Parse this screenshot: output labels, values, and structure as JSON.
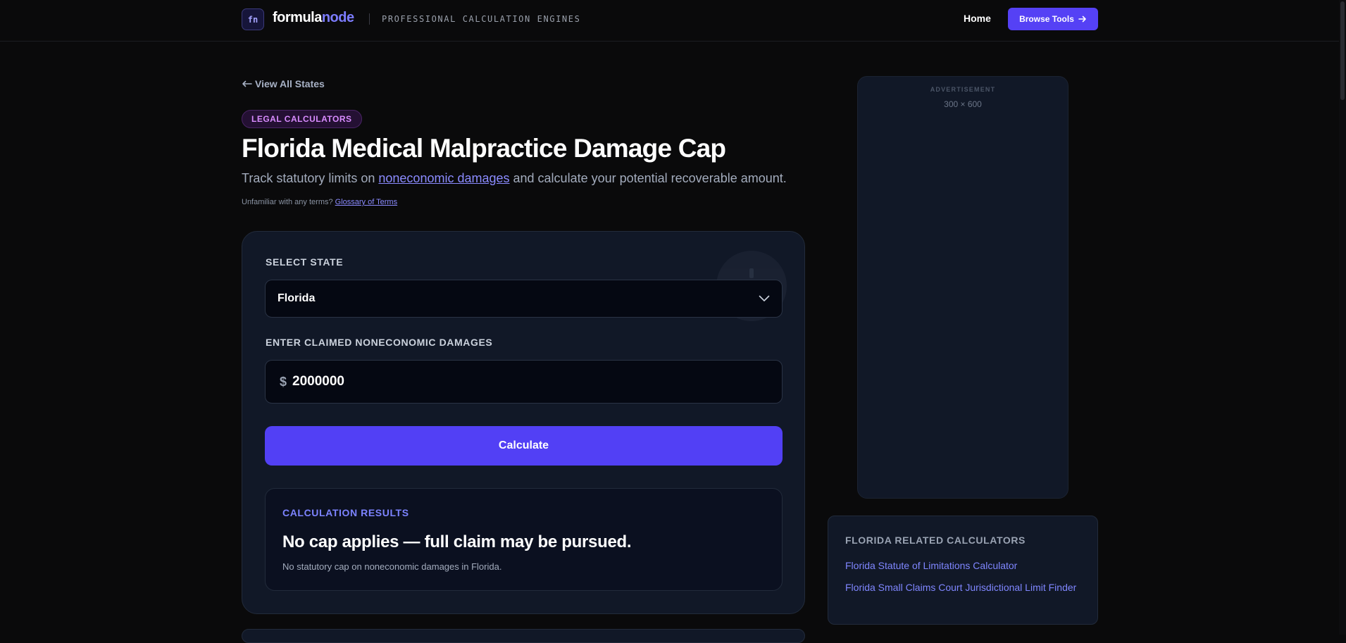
{
  "header": {
    "logo_mark": "fn",
    "brand_main": "formula",
    "brand_accent": "node",
    "tagline": "PROFESSIONAL CALCULATION ENGINES",
    "nav_home": "Home",
    "nav_browse": "Browse Tools"
  },
  "page": {
    "back_link": "View All States",
    "category": "LEGAL CALCULATORS",
    "title": "Florida Medical Malpractice Damage Cap",
    "subtitle_before": "Track statutory limits on ",
    "subtitle_link": "noneconomic damages",
    "subtitle_after": " and calculate your potential recoverable amount.",
    "hint_text": "Unfamiliar with any terms? ",
    "hint_link": "Glossary of Terms"
  },
  "calculator": {
    "state_label": "SELECT STATE",
    "state_value": "Florida",
    "damages_label": "ENTER CLAIMED NONECONOMIC DAMAGES",
    "currency_symbol": "$",
    "damages_value": "2000000",
    "calculate_label": "Calculate"
  },
  "results": {
    "label": "CALCULATION RESULTS",
    "headline": "No cap applies — full claim may be pursued.",
    "note": "No statutory cap on noneconomic damages in Florida."
  },
  "sidebar": {
    "ad_label": "ADVERTISEMENT",
    "ad_size": "300 × 600",
    "related_title": "FLORIDA RELATED CALCULATORS",
    "related_links": [
      "Florida Statute of Limitations Calculator",
      "Florida Small Claims Court Jurisdictional Limit Finder"
    ]
  },
  "colors": {
    "accent": "#5541f5",
    "link": "#7f86ff",
    "badge_text": "#d98cff"
  }
}
